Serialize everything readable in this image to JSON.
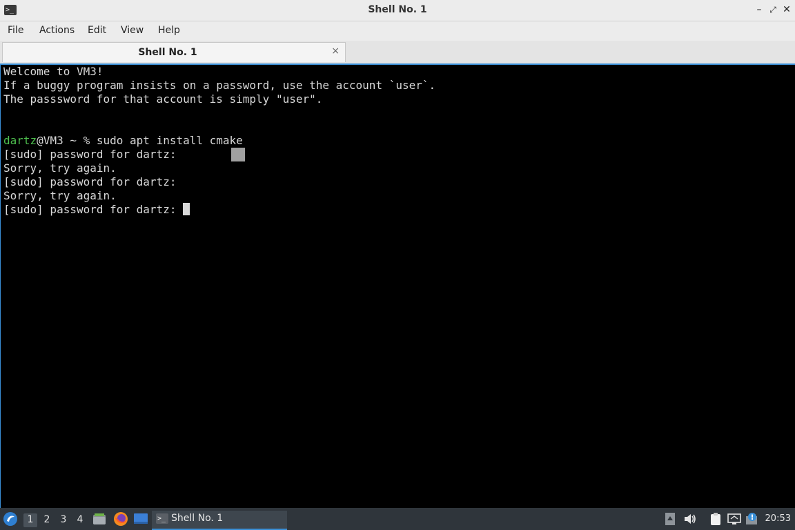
{
  "window": {
    "title": "Shell No. 1",
    "controls": [
      "minimize",
      "maximize",
      "close"
    ]
  },
  "menu": {
    "items": [
      "File",
      "Actions",
      "Edit",
      "View",
      "Help"
    ]
  },
  "tabs": [
    {
      "label": "Shell No. 1",
      "close_symbol": "×"
    }
  ],
  "terminal": {
    "welcome": [
      "Welcome to VM3!",
      "If a buggy program insists on a password, use the account `user`.",
      "The passsword for that account is simply \"user\"."
    ],
    "prompt_user": "dartz",
    "prompt_rest": "@VM3 ~ % sudo apt install cmake",
    "output": [
      "[sudo] password for dartz:",
      "Sorry, try again.",
      "[sudo] password for dartz:",
      "Sorry, try again.",
      "[sudo] password for dartz: "
    ]
  },
  "taskbar": {
    "desktops": [
      "1",
      "2",
      "3",
      "4"
    ],
    "active_desktop": "1",
    "task_label": "Shell No. 1",
    "clock": "20:53"
  },
  "colors": {
    "accent": "#3a8fd6",
    "prompt_user": "#4ec04e",
    "taskbar_bg": "#2f353b"
  }
}
